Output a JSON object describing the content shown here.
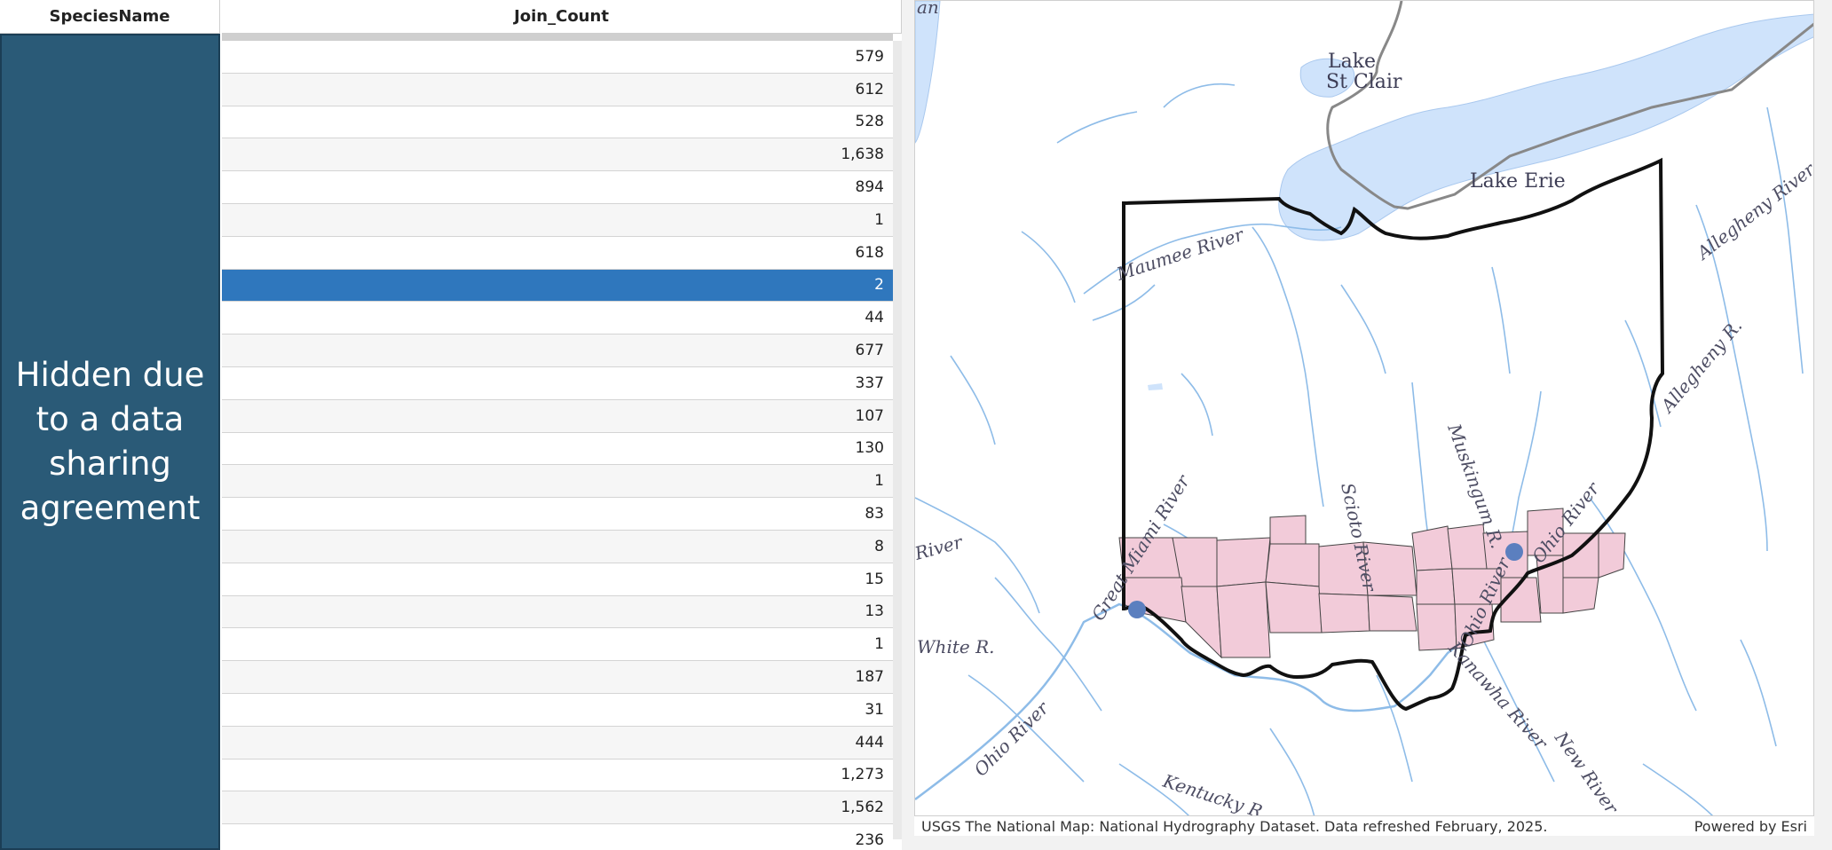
{
  "table": {
    "columns": [
      "SpeciesName",
      "Join_Count"
    ],
    "hidden_note": "Hidden due to a data sharing agreement",
    "join_counts": [
      "579",
      "612",
      "528",
      "1,638",
      "894",
      "1",
      "618",
      "2",
      "44",
      "677",
      "337",
      "107",
      "130",
      "1",
      "83",
      "8",
      "15",
      "13",
      "1",
      "187",
      "31",
      "444",
      "1,273",
      "1,562",
      "236"
    ],
    "selected_row_index": 7,
    "selected_color": "#2f77bd",
    "species_column_color": "#2a5a77"
  },
  "map": {
    "labels": {
      "lake_st_clair": [
        "Lake",
        "St Clair"
      ],
      "lake_erie": "Lake Erie",
      "maumee": "Maumee River",
      "allegheny1": "Allegheny River",
      "allegheny2": "Allegheny R.",
      "great_miami": "Great Miami River",
      "scioto": "Scioto River",
      "muskingum": "Muskingum R.",
      "ohio_r_ne": "Ohio River",
      "ohio_r_mid": "Ohio River",
      "ohio_r_sw": "Ohio River",
      "kanawha": "Kanawha River",
      "new_river": "New River",
      "kentucky": "Kentucky R.",
      "white_r": "White R.",
      "river_left": "River",
      "an": "an"
    },
    "attribution": "USGS The National Map: National Hydrography Dataset. Data refreshed February, 2025.",
    "powered_by": "Powered by Esri",
    "colors": {
      "water": "#cfe3fb",
      "river": "#8ebce8",
      "county_fill": "#f2cbd9",
      "point": "#5b7fbf"
    }
  }
}
